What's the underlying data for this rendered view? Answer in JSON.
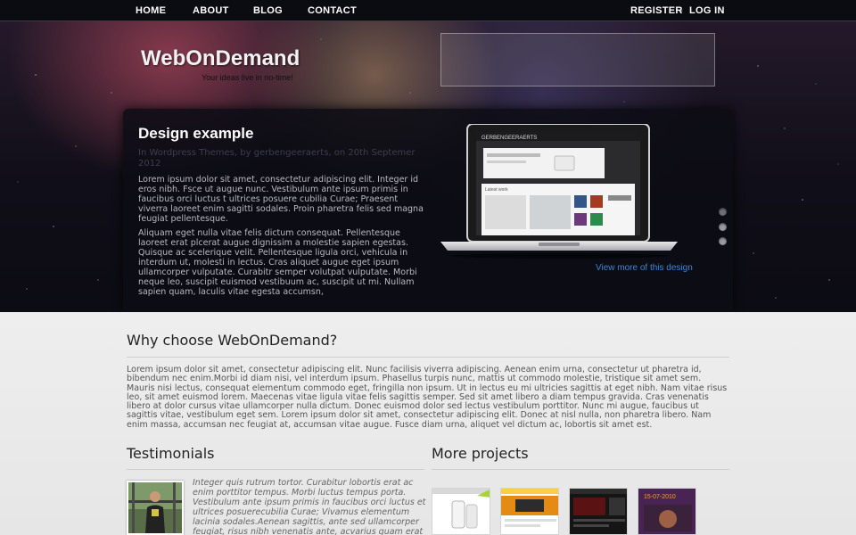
{
  "nav": {
    "left": [
      "HOME",
      "ABOUT",
      "BLOG",
      "CONTACT"
    ],
    "register": "REGISTER",
    "separator": "-",
    "login": "LOG IN"
  },
  "header": {
    "logo": "WebOnDemand",
    "tagline": "Your ideas live in no-time!"
  },
  "slider": {
    "title": "Design example",
    "meta": "In Wordpress Themes, by gerbengeeraerts, on 20th Septemer 2012",
    "paragraph1": "Lorem ipsum dolor sit amet, consectetur adipiscing elit. Integer id eros nibh. Fsce ut augue nunc. Vestibulum ante ipsum primis in faucibus orci luctus t ultrices posuere cubilia Curae; Praesent viverra laoreet enim sagitti sodales. Proin pharetra felis sed magna feugiat pellentesque.",
    "paragraph2": "Aliquam eget nulla vitae felis dictum consequat. Pellentesque laoreet erat plcerat augue dignissim a molestie sapien egestas. Quisque ac scelerique velit. Pellentesque ligula orci, vehicula in interdum ut, molesti in lectus. Cras aliquet augue eget ipsum ullamcorper vulputate. Curabitr semper volutpat vulputate. Morbi neque leo, suscipit euismod vestibuum ac, suscipit ut mi. Nullam sapien quam, laculis vitae egesta accumsn,",
    "view_more": "View more of this design",
    "slide_count": 3,
    "active_slide": 1,
    "screen": {
      "brand": "GERBENGEERAERTS",
      "latest": "Latest work"
    }
  },
  "why": {
    "title": "Why choose WebOnDemand?",
    "text": "Lorem ipsum dolor sit amet, consectetur adipiscing elit. Nunc facilisis viverra adipiscing. Aenean enim urna, consectetur ut pharetra id, bibendum nec enim.Morbi id diam nisi, vel interdum ipsum. Phasellus turpis nunc, mattis ut commodo molestie, tristique sit amet sem. Mauris nisi lectus, consequat elementum commodo eget, fringilla non ipsum. Ut in lectus eu mi ultricies sagittis at eget nibh. Nam vitae risus leo, sit amet euismod lorem. Maecenas vitae ligula vitae felis sagittis semper. Sed sit amet libero a diam tempus gravida. Cras venenatis libero at dolor cursus vitae ullamcorper nulla dictum. Donec euismod dolor sed lectus vestibulum porttitor. Nunc mi augue, faucibus ut sagittis vitae, vestibulum eget sem. Lorem ipsum dolor sit amet, consectetur adipiscing elit. Donec at nisl nulla, non pharetra libero. Nam enim massa, accumsan nec feugiat at, accumsan vitae augue. Fusce diam urna, aliquet vel dictum ac, lobortis sit amet est."
  },
  "testimonials": {
    "title": "Testimonials",
    "quote": "Integer quis rutrum tortor. Curabitur lobortis erat ac enim porttitor tempus. Morbi luctus tempus porta. Vestibulum ante ipsum primis in faucibus orci luctus et ultrices posuerecubilia Curae; Vivamus elementum lacinia sodales.Aenean sagittis, ante sed ullamcorper feugiat, risus nibh venenatis ante, acvarius quam erat vitae odio."
  },
  "projects": {
    "title": "More projects",
    "thumb4_date": "15-07-2010"
  },
  "colors": {
    "link": "#3a86d6",
    "nav_bg": "#0b0b12",
    "content_bg": "#eeeeee"
  }
}
